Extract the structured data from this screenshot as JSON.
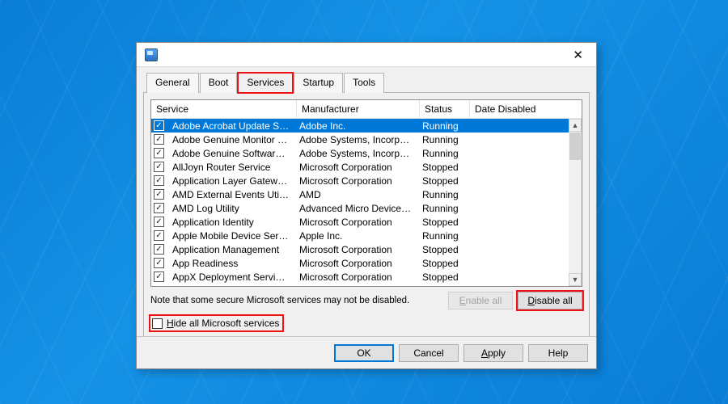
{
  "titlebar": {
    "close": "✕"
  },
  "tabs": {
    "general": "General",
    "boot": "Boot",
    "services": "Services",
    "startup": "Startup",
    "tools": "Tools"
  },
  "columns": {
    "service": "Service",
    "manufacturer": "Manufacturer",
    "status": "Status",
    "date_disabled": "Date Disabled"
  },
  "rows": [
    {
      "checked": true,
      "selected": true,
      "service": "Adobe Acrobat Update Service",
      "manufacturer": "Adobe Inc.",
      "status": "Running",
      "date_disabled": ""
    },
    {
      "checked": true,
      "selected": false,
      "service": "Adobe Genuine Monitor Service",
      "manufacturer": "Adobe Systems, Incorpora...",
      "status": "Running",
      "date_disabled": ""
    },
    {
      "checked": true,
      "selected": false,
      "service": "Adobe Genuine Software Integri...",
      "manufacturer": "Adobe Systems, Incorpora...",
      "status": "Running",
      "date_disabled": ""
    },
    {
      "checked": true,
      "selected": false,
      "service": "AllJoyn Router Service",
      "manufacturer": "Microsoft Corporation",
      "status": "Stopped",
      "date_disabled": ""
    },
    {
      "checked": true,
      "selected": false,
      "service": "Application Layer Gateway Service",
      "manufacturer": "Microsoft Corporation",
      "status": "Stopped",
      "date_disabled": ""
    },
    {
      "checked": true,
      "selected": false,
      "service": "AMD External Events Utility",
      "manufacturer": "AMD",
      "status": "Running",
      "date_disabled": ""
    },
    {
      "checked": true,
      "selected": false,
      "service": "AMD Log Utility",
      "manufacturer": "Advanced Micro Devices, I...",
      "status": "Running",
      "date_disabled": ""
    },
    {
      "checked": true,
      "selected": false,
      "service": "Application Identity",
      "manufacturer": "Microsoft Corporation",
      "status": "Stopped",
      "date_disabled": ""
    },
    {
      "checked": true,
      "selected": false,
      "service": "Apple Mobile Device Service",
      "manufacturer": "Apple Inc.",
      "status": "Running",
      "date_disabled": ""
    },
    {
      "checked": true,
      "selected": false,
      "service": "Application Management",
      "manufacturer": "Microsoft Corporation",
      "status": "Stopped",
      "date_disabled": ""
    },
    {
      "checked": true,
      "selected": false,
      "service": "App Readiness",
      "manufacturer": "Microsoft Corporation",
      "status": "Stopped",
      "date_disabled": ""
    },
    {
      "checked": true,
      "selected": false,
      "service": "AppX Deployment Service (AppX...",
      "manufacturer": "Microsoft Corporation",
      "status": "Stopped",
      "date_disabled": ""
    }
  ],
  "note": "Note that some secure Microsoft services may not be disabled.",
  "buttons": {
    "enable_prefix": "E",
    "enable_rest": "nable all",
    "disable_prefix": "D",
    "disable_rest": "isable all",
    "hide_prefix": "H",
    "hide_rest": "ide all Microsoft services",
    "ok": "OK",
    "cancel": "Cancel",
    "apply_prefix": "A",
    "apply_rest": "pply",
    "help": "Help"
  }
}
